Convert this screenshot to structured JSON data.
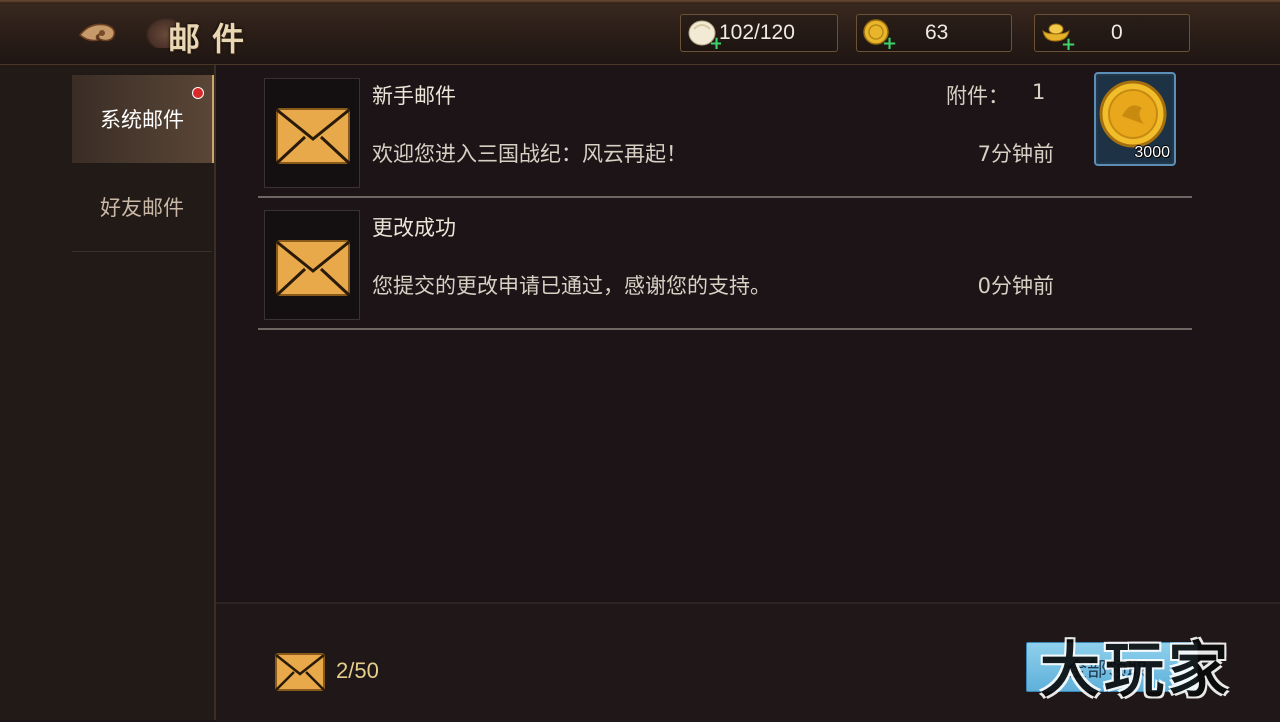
{
  "header": {
    "title": "邮件",
    "resources": [
      {
        "icon": "bun-stamina-icon",
        "value": "102/120"
      },
      {
        "icon": "gold-coin-icon",
        "value": "63"
      },
      {
        "icon": "gold-ingot-icon",
        "value": "0"
      }
    ]
  },
  "sidebar": {
    "tabs": [
      {
        "label": "系统邮件",
        "active": true,
        "has_notification": true
      },
      {
        "label": "好友邮件",
        "active": false,
        "has_notification": false
      }
    ]
  },
  "mails": [
    {
      "title": "新手邮件",
      "body": "欢迎您进入三国战纪：风云再起！",
      "time": "7分钟前",
      "attachment_label": "附件：",
      "attachment_count": "1",
      "attachment_amount": "3000",
      "attachment_icon": "gold-coin-icon"
    },
    {
      "title": "更改成功",
      "body": "您提交的更改申请已通过，感谢您的支持。",
      "time": "0分钟前"
    }
  ],
  "footer": {
    "mail_count": "2/50",
    "collect_all_label": "全部领取",
    "watermark": "大玩家"
  },
  "colors": {
    "accent_gold": "#e6cf8a",
    "button_blue": "#6fbde2",
    "notification_red": "#d82a2a"
  }
}
